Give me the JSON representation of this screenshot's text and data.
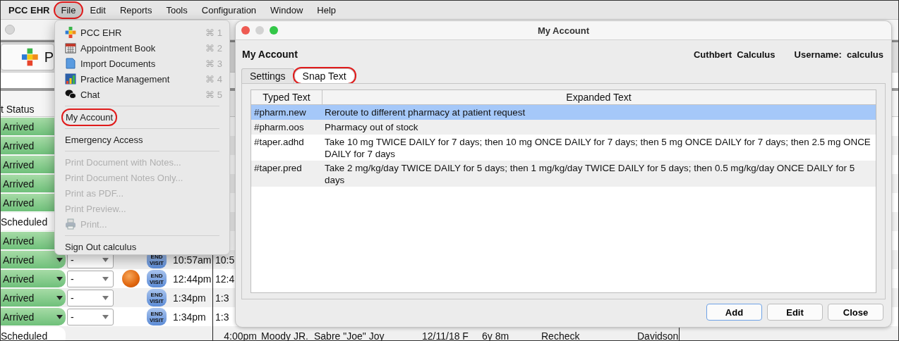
{
  "menubar": {
    "app": "PCC EHR",
    "menus": [
      {
        "label": "File",
        "selected": true,
        "annotated": true
      },
      {
        "label": "Edit",
        "selected": false,
        "annotated": false
      },
      {
        "label": "Reports",
        "selected": false,
        "annotated": false
      },
      {
        "label": "Tools",
        "selected": false,
        "annotated": false
      },
      {
        "label": "Configuration",
        "selected": false,
        "annotated": false
      },
      {
        "label": "Window",
        "selected": false,
        "annotated": false
      },
      {
        "label": "Help",
        "selected": false,
        "annotated": false
      }
    ]
  },
  "background": {
    "logo_text": "P",
    "status_header": "t Status",
    "rows": [
      {
        "status": "Arrived",
        "kind": "arrived"
      },
      {
        "status": "Arrived",
        "kind": "arrived"
      },
      {
        "status": "Arrived",
        "kind": "arrived"
      },
      {
        "status": "Arrived",
        "kind": "arrived"
      },
      {
        "status": "Arrived",
        "kind": "arrived"
      },
      {
        "status": "Scheduled",
        "kind": "scheduled"
      },
      {
        "status": "Arrived",
        "kind": "arrived"
      },
      {
        "status": "Arrived",
        "kind": "arrived",
        "caret": true,
        "select": "-",
        "badge": [
          "END",
          "VISIT"
        ],
        "time": "10:57am",
        "time2": "10:5"
      },
      {
        "status": "Arrived",
        "kind": "arrived",
        "caret": true,
        "select": "-",
        "flag": true,
        "badge": [
          "END",
          "VISIT"
        ],
        "time": "12:44pm",
        "time2": "12:4"
      },
      {
        "status": "Arrived",
        "kind": "arrived",
        "caret": true,
        "select": "-",
        "badge": [
          "END",
          "VISIT"
        ],
        "time": "1:34pm",
        "time2": "1:3"
      },
      {
        "status": "Arrived",
        "kind": "arrived",
        "caret": true,
        "select": "-",
        "badge": [
          "END",
          "VISIT"
        ],
        "time": "1:34pm",
        "time2": "1:3"
      },
      {
        "status": "Scheduled",
        "kind": "scheduled",
        "time2": "4:00pm",
        "cells": [
          "Moody JR.",
          "Sabre \"Joe\" Joy",
          "12/11/18 F",
          "6y 8m",
          "Recheck",
          "Davidson"
        ]
      }
    ]
  },
  "file_menu": {
    "items": [
      {
        "kind": "command",
        "label": "PCC EHR",
        "shortcut": "⌘ 1",
        "disabled": false,
        "annotated": false
      },
      {
        "kind": "command",
        "label": "Appointment Book",
        "shortcut": "⌘ 2",
        "disabled": false,
        "annotated": false
      },
      {
        "kind": "command",
        "label": "Import Documents",
        "shortcut": "⌘ 3",
        "disabled": false,
        "annotated": false
      },
      {
        "kind": "command",
        "label": "Practice Management",
        "shortcut": "⌘ 4",
        "disabled": false,
        "annotated": false
      },
      {
        "kind": "command",
        "label": "Chat",
        "shortcut": "⌘ 5",
        "disabled": false,
        "annotated": false
      },
      {
        "kind": "separator"
      },
      {
        "kind": "command",
        "label": "My Account",
        "disabled": false,
        "annotated": true
      },
      {
        "kind": "separator"
      },
      {
        "kind": "command",
        "label": "Emergency Access",
        "disabled": false,
        "annotated": false
      },
      {
        "kind": "separator"
      },
      {
        "kind": "command",
        "label": "Print Document with Notes...",
        "disabled": true,
        "annotated": false
      },
      {
        "kind": "command",
        "label": "Print Document Notes Only...",
        "disabled": true,
        "annotated": false
      },
      {
        "kind": "command",
        "label": "Print as PDF...",
        "disabled": true,
        "annotated": false
      },
      {
        "kind": "command",
        "label": "Print Preview...",
        "disabled": true,
        "annotated": false
      },
      {
        "kind": "command",
        "label": "Print...",
        "disabled": true,
        "annotated": false
      },
      {
        "kind": "separator"
      },
      {
        "kind": "command",
        "label": "Sign Out calculus",
        "disabled": false,
        "annotated": false
      }
    ]
  },
  "dialog": {
    "title": "My Account",
    "heading": "My Account",
    "user_name": "Cuthbert  Calculus",
    "username": "Username:  calculus",
    "tabs": [
      {
        "label": "Settings",
        "selected": false,
        "annotated": false
      },
      {
        "label": "Snap Text",
        "selected": true,
        "annotated": true
      }
    ],
    "table": {
      "columns": [
        "Typed Text",
        "Expanded Text"
      ],
      "rows": [
        {
          "typed": "#pharm.new",
          "expanded": "Reroute to different pharmacy at patient request",
          "selected": true
        },
        {
          "typed": "#pharm.oos",
          "expanded": "Pharmacy out of stock",
          "selected": false
        },
        {
          "typed": "#taper.adhd",
          "expanded": "Take 10 mg TWICE DAILY for 7 days; then 10 mg ONCE DAILY for 7 days; then 5 mg ONCE DAILY for 7 days; then 2.5 mg ONCE DAILY for 7 days",
          "selected": false
        },
        {
          "typed": "#taper.pred",
          "expanded": "Take 2 mg/kg/day TWICE DAILY for 5 days; then 1 mg/kg/day TWICE DAILY for 5 days; then 0.5 mg/kg/day ONCE DAILY for 5 days",
          "selected": false
        }
      ]
    },
    "buttons": [
      {
        "label": "Add",
        "default": true
      },
      {
        "label": "Edit",
        "default": false
      },
      {
        "label": "Close",
        "default": false
      }
    ]
  }
}
